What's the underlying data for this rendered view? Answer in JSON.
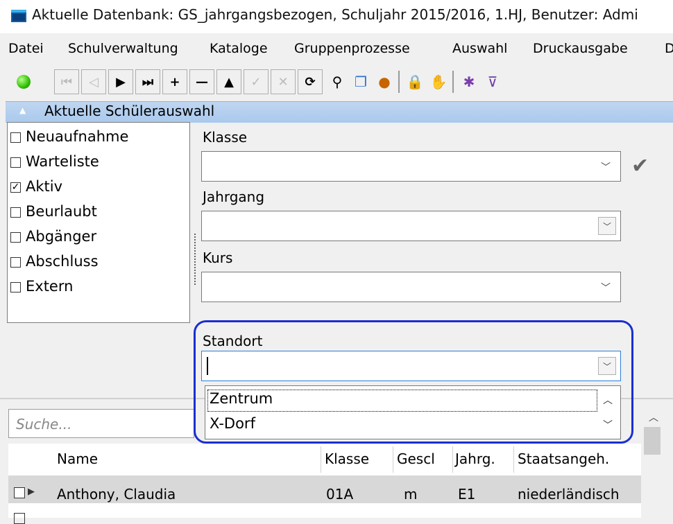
{
  "window": {
    "title": "Aktuelle Datenbank: GS_jahrgangsbezogen, Schuljahr 2015/2016, 1.HJ, Benutzer: Admi"
  },
  "menu": [
    {
      "label": "Datei"
    },
    {
      "label": "Schulverwaltung"
    },
    {
      "label": "Kataloge"
    },
    {
      "label": "Gruppenprozesse"
    },
    {
      "label": "Auswahl"
    },
    {
      "label": "Druckausgabe"
    },
    {
      "label": "D"
    }
  ],
  "toolbar": {
    "status_color": "#33cc00",
    "icons": [
      "first-record-icon",
      "previous-record-icon",
      "next-record-icon",
      "last-record-icon",
      "add-record-icon",
      "delete-record-icon",
      "up-icon",
      "confirm-icon",
      "cancel-icon",
      "refresh-icon",
      "search-key-icon",
      "copy-icon",
      "user-icon",
      "lock-icon",
      "hand-icon",
      "filter-color-icon",
      "filter-icon"
    ]
  },
  "section": {
    "title": "Aktuelle Schülerauswahl"
  },
  "status_filters": [
    {
      "label": "Neuaufnahme",
      "checked": false
    },
    {
      "label": "Warteliste",
      "checked": false
    },
    {
      "label": "Aktiv",
      "checked": true
    },
    {
      "label": "Beurlaubt",
      "checked": false
    },
    {
      "label": "Abgänger",
      "checked": false
    },
    {
      "label": "Abschluss",
      "checked": false
    },
    {
      "label": "Extern",
      "checked": false
    }
  ],
  "fields": {
    "klasse": {
      "label": "Klasse",
      "value": ""
    },
    "jahrgang": {
      "label": "Jahrgang",
      "value": ""
    },
    "kurs": {
      "label": "Kurs",
      "value": ""
    },
    "standort": {
      "label": "Standort",
      "value": "",
      "options": [
        "Zentrum",
        "X-Dorf"
      ]
    }
  },
  "search": {
    "placeholder": "Suche..."
  },
  "grid": {
    "columns": [
      "Name",
      "Klasse",
      "Gescl",
      "Jahrg.",
      "Staatsangeh."
    ],
    "rows": [
      {
        "name": "Anthony, Claudia",
        "klasse": "01A",
        "geschlecht": "m",
        "jahrgang": "E1",
        "staatsangehoerigkeit": "niederländisch"
      }
    ]
  },
  "colors": {
    "highlight": "#1a2fd0",
    "section_header": "#a9c9ee"
  }
}
